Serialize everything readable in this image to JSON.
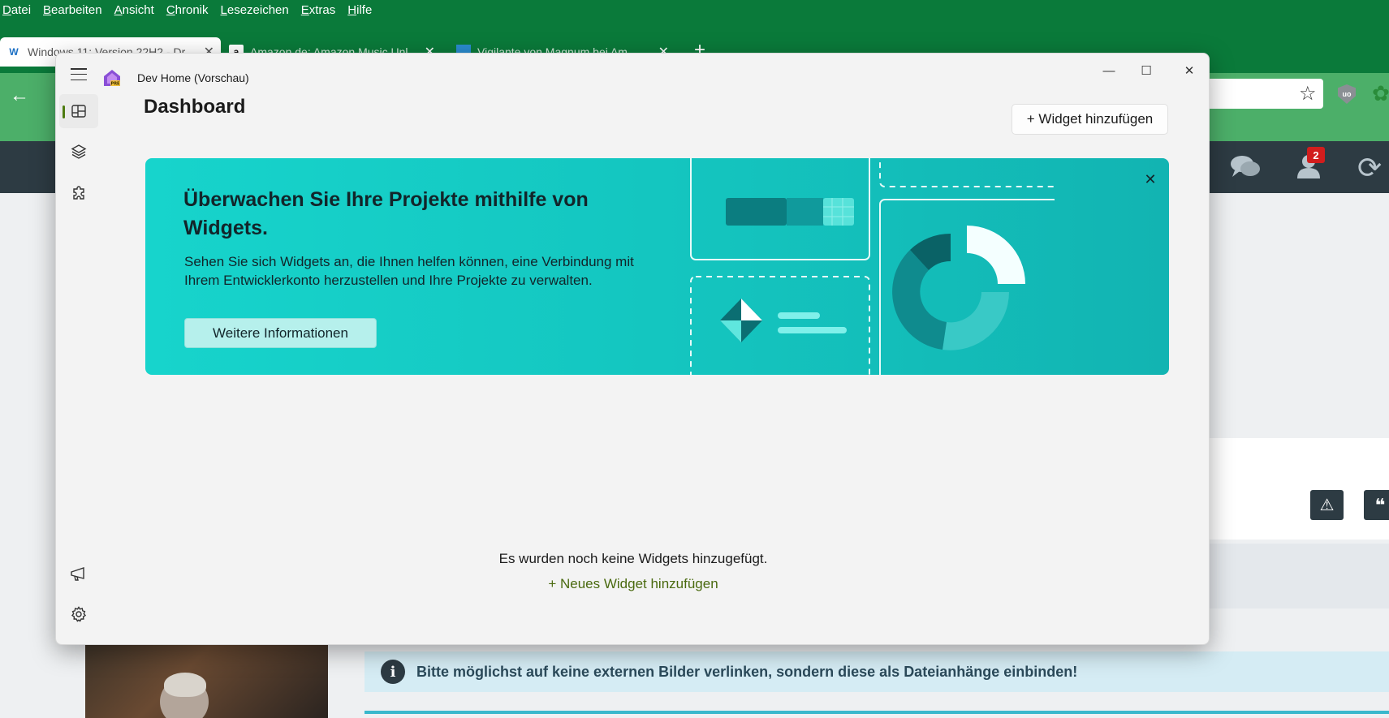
{
  "browser": {
    "menu": [
      {
        "label": "Datei",
        "accel": "D"
      },
      {
        "label": "Bearbeiten",
        "accel": "B"
      },
      {
        "label": "Ansicht",
        "accel": "A"
      },
      {
        "label": "Chronik",
        "accel": "C"
      },
      {
        "label": "Lesezeichen",
        "accel": "L"
      },
      {
        "label": "Extras",
        "accel": "E"
      },
      {
        "label": "Hilfe",
        "accel": "H"
      }
    ],
    "tabs": [
      {
        "title": "Windows 11: Version 22H2 - Dr",
        "favicon": "W",
        "active": true
      },
      {
        "title": "Amazon.de: Amazon Music Unl",
        "favicon": "a",
        "active": false
      },
      {
        "title": "Vigilante von Magnum bei Am",
        "favicon": "",
        "active": false
      }
    ],
    "new_tab_label": "+",
    "notification_count": "2",
    "info_banner": "Bitte möglichst auf keine externen Bilder verlinken, sondern diese als Dateianhänge einbinden!",
    "colors": {
      "menubar": "#0a7a3a",
      "navbar": "#4caf69",
      "site_header": "#2d3b43"
    }
  },
  "devhome": {
    "app_title": "Dev Home (Vorschau)",
    "window_controls": {
      "minimize": "—",
      "maximize": "☐",
      "close": "✕"
    },
    "nav_rail": {
      "top": [
        {
          "icon": "dashboard-icon",
          "selected": true
        },
        {
          "icon": "layers-icon",
          "selected": false
        },
        {
          "icon": "puzzle-icon",
          "selected": false
        }
      ],
      "bottom": [
        {
          "icon": "megaphone-icon"
        },
        {
          "icon": "gear-icon"
        }
      ]
    },
    "page_title": "Dashboard",
    "add_widget_button": "+ Widget hinzufügen",
    "hero": {
      "title": "Überwachen Sie Ihre Projekte mithilfe von Widgets.",
      "description": "Sehen Sie sich Widgets an, die Ihnen helfen können, eine Verbindung mit Ihrem Entwicklerkonto herzustellen und Ihre Projekte zu verwalten.",
      "button": "Weitere Informationen",
      "close": "✕",
      "color": "#17d4cc"
    },
    "empty_state": {
      "message": "Es wurden noch keine Widgets hinzugefügt.",
      "link": "+ Neues Widget hinzufügen"
    },
    "accent_color": "#4c7a0f"
  }
}
